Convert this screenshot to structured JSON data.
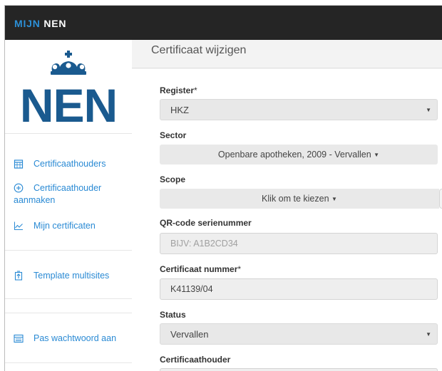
{
  "header": {
    "brand_part1": "MIJN",
    "brand_part2": "NEN"
  },
  "sidebar": {
    "logo_text": "NEN",
    "items": [
      {
        "label": "Certificaathouders",
        "icon": "calendar-icon"
      },
      {
        "label": "Certificaathouder aanmaken",
        "icon": "plus-circle-icon"
      },
      {
        "label": "Mijn certificaten",
        "icon": "line-chart-icon"
      },
      {
        "label": "Template multisites",
        "icon": "document-upload-icon"
      },
      {
        "label": "Pas wachtwoord aan",
        "icon": "keyboard-icon"
      }
    ]
  },
  "page": {
    "title": "Certificaat wijzigen"
  },
  "form": {
    "register": {
      "label": "Register",
      "required_mark": "*",
      "value": "HKZ"
    },
    "sector": {
      "label": "Sector",
      "value": "Openbare apotheken, 2009 - Vervallen"
    },
    "scope": {
      "label": "Scope",
      "value": "Klik om te kiezen"
    },
    "qr_code": {
      "label": "QR-code serienummer",
      "placeholder": "BIJV: A1B2CD34"
    },
    "certificate_number": {
      "label": "Certificaat nummer",
      "required_mark": "*",
      "value": "K41139/04"
    },
    "status": {
      "label": "Status",
      "value": "Vervallen"
    },
    "holder": {
      "label": "Certificaathouder"
    }
  },
  "colors": {
    "topbar": "#252525",
    "accent": "#2c8fd6",
    "logo_blue": "#1a5a8f",
    "link": "#2a8ad4"
  }
}
